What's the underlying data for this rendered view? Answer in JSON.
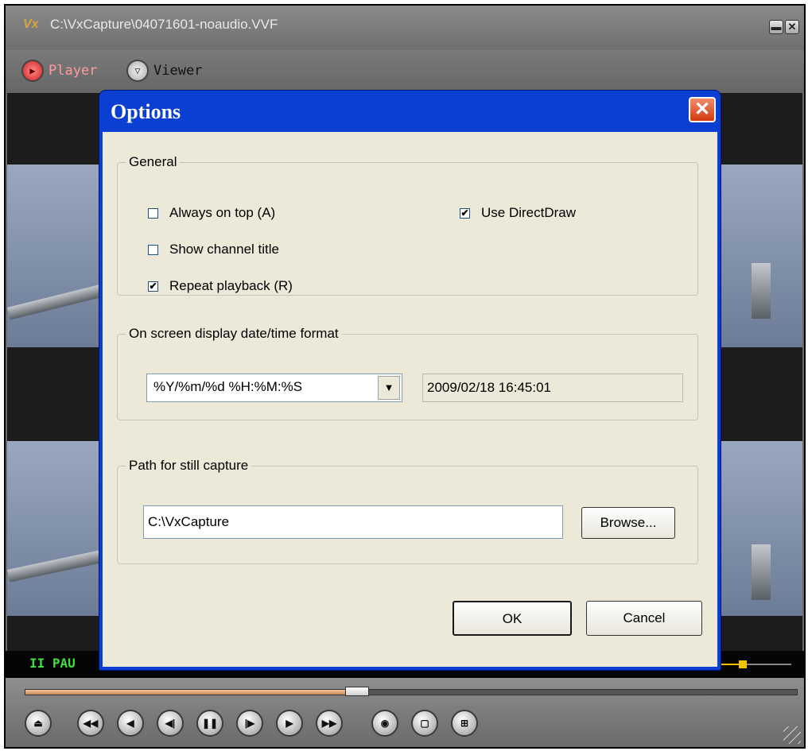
{
  "window": {
    "logo": "Vx",
    "title": "C:\\VxCapture\\04071601-noaudio.VVF",
    "minimize_glyph": "▬",
    "close_glyph": "✕"
  },
  "modes": {
    "player_label": "Player",
    "viewer_label": "Viewer"
  },
  "status": {
    "pause_text": "II  PAU",
    "volume_level": 0.28
  },
  "seek": {
    "position_fraction": 0.43
  },
  "controls": {
    "buttons": [
      "open-icon",
      "skip-start-icon",
      "prev-frame-icon",
      "step-back-icon",
      "pause-icon",
      "step-forward-icon",
      "next-frame-icon",
      "skip-end-icon",
      "snapshot-icon",
      "single-view-icon",
      "quad-view-icon"
    ]
  },
  "dialog": {
    "title": "Options",
    "close_glyph": "✕",
    "general": {
      "legend": "General",
      "always_on_top": {
        "label": "Always on top (A)",
        "checked": false
      },
      "show_channel_title": {
        "label": "Show channel title",
        "checked": false
      },
      "repeat_playback": {
        "label": "Repeat playback (R)",
        "checked": true
      },
      "use_directdraw": {
        "label": "Use DirectDraw",
        "checked": true
      }
    },
    "osd": {
      "legend": "On screen display date/time format",
      "format_value": "%Y/%m/%d %H:%M:%S",
      "preview_value": "2009/02/18 16:45:01"
    },
    "still_capture": {
      "legend": "Path for still capture",
      "path_value": "C:\\VxCapture",
      "browse_label": "Browse..."
    },
    "ok_label": "OK",
    "cancel_label": "Cancel"
  }
}
